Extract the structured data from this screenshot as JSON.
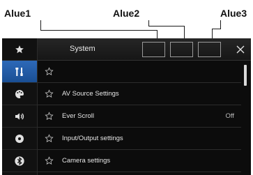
{
  "annotations": {
    "labels": [
      "Alue1",
      "Alue2",
      "Alue3"
    ]
  },
  "sidebar": {
    "items": [
      {
        "icon": "star-icon",
        "active": false
      },
      {
        "icon": "tools-icon",
        "active": true
      },
      {
        "icon": "theme-icon",
        "active": false
      },
      {
        "icon": "speaker-icon",
        "active": false
      },
      {
        "icon": "disc-icon",
        "active": false
      },
      {
        "icon": "bluetooth-icon",
        "active": false
      }
    ]
  },
  "header": {
    "title": "System",
    "close_icon": "close-icon"
  },
  "menu": {
    "items": [
      {
        "label": "",
        "value": ""
      },
      {
        "label": "AV Source Settings",
        "value": ""
      },
      {
        "label": "Ever Scroll",
        "value": "Off"
      },
      {
        "label": "Input/Output settings",
        "value": ""
      },
      {
        "label": "Camera settings",
        "value": ""
      }
    ]
  },
  "colors": {
    "active_rail": "#2d69b8",
    "background": "#0c0c0c",
    "text": "#e6e6e6"
  }
}
